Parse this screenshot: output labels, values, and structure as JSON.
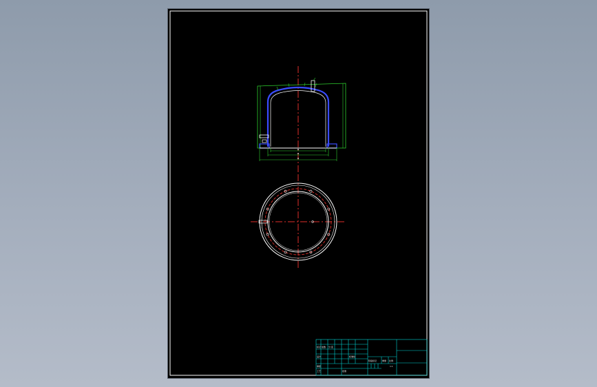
{
  "sheet": {
    "background": "#000000",
    "frame_color": "#ffffff",
    "outline_color": "#2fd12f",
    "centerline_color": "#e0302a",
    "shell_color": "#3a4cff",
    "ring_color": "#ffffff",
    "title_block_color": "#00d7d7"
  },
  "title_block": {
    "labels": {
      "a": "标记",
      "b": "处数",
      "c": "分 区",
      "d": "设计",
      "e": "标准化",
      "f": "阶段标记",
      "g": "重量",
      "h": "比例",
      "i": "审核",
      "j": "工艺",
      "k": "批准",
      "l": "1:1"
    }
  }
}
